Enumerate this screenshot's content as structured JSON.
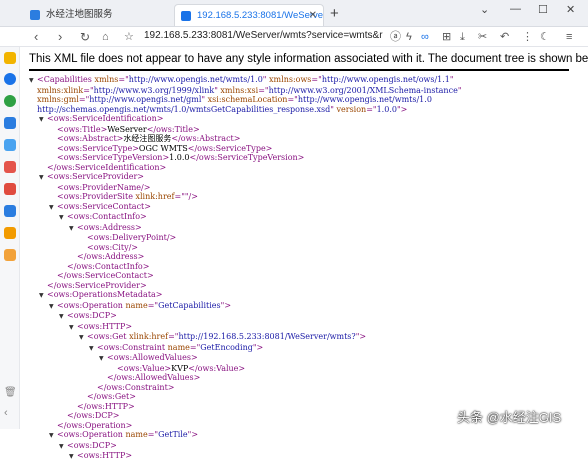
{
  "browser": {
    "tabs": [
      {
        "label": "水经注地图服务",
        "active": false
      },
      {
        "label": "192.168.5.233:8081/WeServer/w",
        "active": true
      }
    ],
    "new_tab": "+",
    "address": "192.168.5.233:8081/WeServer/wmts?service=wmts&r"
  },
  "notice": "This XML file does not appear to have any style information associated with it. The document tree is shown below.",
  "watermark": "头条 @水经注GIS",
  "colors": {
    "tag": "#881280",
    "attr": "#994500",
    "value": "#1a1aa6",
    "accent": "#1a73e8"
  },
  "xml_lines": [
    {
      "d": 0,
      "tri": "▼",
      "parts": [
        [
          "t",
          "<Capabilities "
        ],
        [
          "a",
          "xmlns"
        ],
        [
          "t",
          "=\""
        ],
        [
          "v",
          "http://www.opengis.net/wmts/1.0"
        ],
        [
          "t",
          "\" "
        ],
        [
          "a",
          "xmlns:ows"
        ],
        [
          "t",
          "=\""
        ],
        [
          "v",
          "http://www.opengis.net/ows/1.1"
        ],
        [
          "t",
          "\""
        ]
      ]
    },
    {
      "d": 0,
      "tri": "",
      "parts": [
        [
          "a",
          "xmlns:xlink"
        ],
        [
          "t",
          "=\""
        ],
        [
          "v",
          "http://www.w3.org/1999/xlink"
        ],
        [
          "t",
          "\" "
        ],
        [
          "a",
          "xmlns:xsi"
        ],
        [
          "t",
          "=\""
        ],
        [
          "v",
          "http://www.w3.org/2001/XMLSchema-instance"
        ],
        [
          "t",
          "\""
        ]
      ]
    },
    {
      "d": 0,
      "tri": "",
      "parts": [
        [
          "a",
          "xmlns:gml"
        ],
        [
          "t",
          "=\""
        ],
        [
          "v",
          "http://www.opengis.net/gml"
        ],
        [
          "t",
          "\" "
        ],
        [
          "a",
          "xsi:schemaLocation"
        ],
        [
          "t",
          "=\""
        ],
        [
          "v",
          "http://www.opengis.net/wmts/1.0"
        ]
      ]
    },
    {
      "d": 0,
      "tri": "",
      "parts": [
        [
          "v",
          "http://schemas.opengis.net/wmts/1.0/wmtsGetCapabilities_response.xsd"
        ],
        [
          "t",
          "\" "
        ],
        [
          "a",
          "version"
        ],
        [
          "t",
          "=\""
        ],
        [
          "v",
          "1.0.0"
        ],
        [
          "t",
          "\">"
        ]
      ]
    },
    {
      "d": 1,
      "tri": "▼",
      "parts": [
        [
          "t",
          "<ows:ServiceIdentification>"
        ]
      ]
    },
    {
      "d": 2,
      "tri": "",
      "parts": [
        [
          "t",
          "<ows:Title>"
        ],
        [
          "x",
          "WeServer"
        ],
        [
          "t",
          "</ows:Title>"
        ]
      ]
    },
    {
      "d": 2,
      "tri": "",
      "parts": [
        [
          "t",
          "<ows:Abstract>"
        ],
        [
          "x",
          "水经注图服务"
        ],
        [
          "t",
          "</ows:Abstract>"
        ]
      ]
    },
    {
      "d": 2,
      "tri": "",
      "parts": [
        [
          "t",
          "<ows:ServiceType>"
        ],
        [
          "x",
          "OGC WMTS"
        ],
        [
          "t",
          "</ows:ServiceType>"
        ]
      ]
    },
    {
      "d": 2,
      "tri": "",
      "parts": [
        [
          "t",
          "<ows:ServiceTypeVersion>"
        ],
        [
          "x",
          "1.0.0"
        ],
        [
          "t",
          "</ows:ServiceTypeVersion>"
        ]
      ]
    },
    {
      "d": 1,
      "tri": "",
      "parts": [
        [
          "t",
          "</ows:ServiceIdentification>"
        ]
      ]
    },
    {
      "d": 1,
      "tri": "▼",
      "parts": [
        [
          "t",
          "<ows:ServiceProvider>"
        ]
      ]
    },
    {
      "d": 2,
      "tri": "",
      "parts": [
        [
          "t",
          "<ows:ProviderName/>"
        ]
      ]
    },
    {
      "d": 2,
      "tri": "",
      "parts": [
        [
          "t",
          "<ows:ProviderSite "
        ],
        [
          "a",
          "xlink:href"
        ],
        [
          "t",
          "=\""
        ],
        [
          "v",
          ""
        ],
        [
          "t",
          "\"/>"
        ]
      ]
    },
    {
      "d": 2,
      "tri": "▼",
      "parts": [
        [
          "t",
          "<ows:ServiceContact>"
        ]
      ]
    },
    {
      "d": 3,
      "tri": "▼",
      "parts": [
        [
          "t",
          "<ows:ContactInfo>"
        ]
      ]
    },
    {
      "d": 4,
      "tri": "▼",
      "parts": [
        [
          "t",
          "<ows:Address>"
        ]
      ]
    },
    {
      "d": 5,
      "tri": "",
      "parts": [
        [
          "t",
          "<ows:DeliveryPoint/>"
        ]
      ]
    },
    {
      "d": 5,
      "tri": "",
      "parts": [
        [
          "t",
          "<ows:City/>"
        ]
      ]
    },
    {
      "d": 4,
      "tri": "",
      "parts": [
        [
          "t",
          "</ows:Address>"
        ]
      ]
    },
    {
      "d": 3,
      "tri": "",
      "parts": [
        [
          "t",
          "</ows:ContactInfo>"
        ]
      ]
    },
    {
      "d": 2,
      "tri": "",
      "parts": [
        [
          "t",
          "</ows:ServiceContact>"
        ]
      ]
    },
    {
      "d": 1,
      "tri": "",
      "parts": [
        [
          "t",
          "</ows:ServiceProvider>"
        ]
      ]
    },
    {
      "d": 1,
      "tri": "▼",
      "parts": [
        [
          "t",
          "<ows:OperationsMetadata>"
        ]
      ]
    },
    {
      "d": 2,
      "tri": "▼",
      "parts": [
        [
          "t",
          "<ows:Operation "
        ],
        [
          "a",
          "name"
        ],
        [
          "t",
          "=\""
        ],
        [
          "v",
          "GetCapabilities"
        ],
        [
          "t",
          "\">"
        ]
      ]
    },
    {
      "d": 3,
      "tri": "▼",
      "parts": [
        [
          "t",
          "<ows:DCP>"
        ]
      ]
    },
    {
      "d": 4,
      "tri": "▼",
      "parts": [
        [
          "t",
          "<ows:HTTP>"
        ]
      ]
    },
    {
      "d": 5,
      "tri": "▼",
      "parts": [
        [
          "t",
          "<ows:Get "
        ],
        [
          "a",
          "xlink:href"
        ],
        [
          "t",
          "=\""
        ],
        [
          "v",
          "http://192.168.5.233:8081/WeServer/wmts?"
        ],
        [
          "t",
          "\">"
        ]
      ]
    },
    {
      "d": 6,
      "tri": "▼",
      "parts": [
        [
          "t",
          "<ows:Constraint "
        ],
        [
          "a",
          "name"
        ],
        [
          "t",
          "=\""
        ],
        [
          "v",
          "GetEncoding"
        ],
        [
          "t",
          "\">"
        ]
      ]
    },
    {
      "d": 7,
      "tri": "▼",
      "parts": [
        [
          "t",
          "<ows:AllowedValues>"
        ]
      ]
    },
    {
      "d": 8,
      "tri": "",
      "parts": [
        [
          "t",
          "<ows:Value>"
        ],
        [
          "x",
          "KVP"
        ],
        [
          "t",
          "</ows:Value>"
        ]
      ]
    },
    {
      "d": 7,
      "tri": "",
      "parts": [
        [
          "t",
          "</ows:AllowedValues>"
        ]
      ]
    },
    {
      "d": 6,
      "tri": "",
      "parts": [
        [
          "t",
          "</ows:Constraint>"
        ]
      ]
    },
    {
      "d": 5,
      "tri": "",
      "parts": [
        [
          "t",
          "</ows:Get>"
        ]
      ]
    },
    {
      "d": 4,
      "tri": "",
      "parts": [
        [
          "t",
          "</ows:HTTP>"
        ]
      ]
    },
    {
      "d": 3,
      "tri": "",
      "parts": [
        [
          "t",
          "</ows:DCP>"
        ]
      ]
    },
    {
      "d": 2,
      "tri": "",
      "parts": [
        [
          "t",
          "</ows:Operation>"
        ]
      ]
    },
    {
      "d": 2,
      "tri": "▼",
      "parts": [
        [
          "t",
          "<ows:Operation "
        ],
        [
          "a",
          "name"
        ],
        [
          "t",
          "=\""
        ],
        [
          "v",
          "GetTile"
        ],
        [
          "t",
          "\">"
        ]
      ]
    },
    {
      "d": 3,
      "tri": "▼",
      "parts": [
        [
          "t",
          "<ows:DCP>"
        ]
      ]
    },
    {
      "d": 4,
      "tri": "▼",
      "parts": [
        [
          "t",
          "<ows:HTTP>"
        ]
      ]
    }
  ]
}
